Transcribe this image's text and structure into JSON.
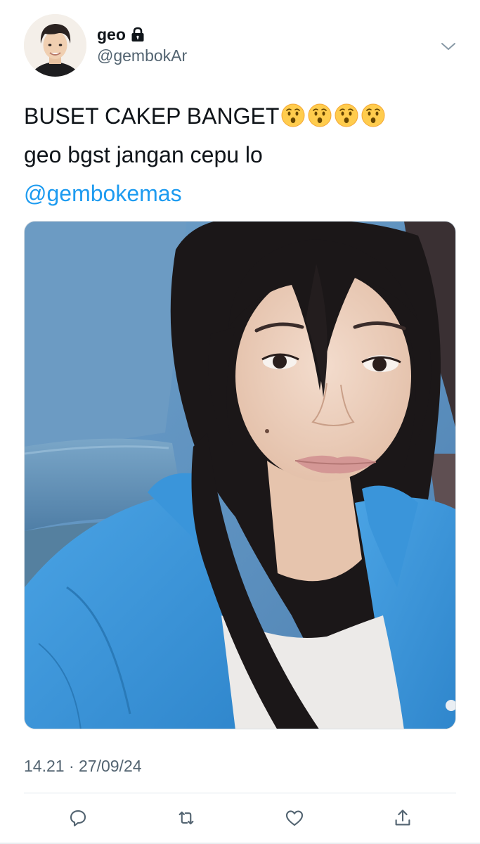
{
  "author": {
    "display_name": "geo",
    "handle": "@gembokAr",
    "avatar_icon": "avatar-photo",
    "protected_icon": "lock-icon"
  },
  "tweet": {
    "line1": "BUSET CAKEP BANGET",
    "line1_emoji": [
      "hushed-face-emoji",
      "hushed-face-emoji",
      "hushed-face-emoji",
      "hushed-face-emoji"
    ],
    "line2": "geo bgst jangan cepu lo",
    "mention": "@gembokemas"
  },
  "media": {
    "kind": "photo",
    "subject": "selfie"
  },
  "timestamp": "14.21 · 27/09/24",
  "actions": [
    {
      "name": "reply",
      "icon": "reply-icon"
    },
    {
      "name": "retweet",
      "icon": "retweet-icon"
    },
    {
      "name": "like",
      "icon": "heart-icon"
    },
    {
      "name": "share",
      "icon": "share-icon"
    }
  ],
  "colors": {
    "link": "#1d9bf0",
    "secondary_text": "#536471",
    "icon": "#536471",
    "primary_text": "#0f1419"
  }
}
